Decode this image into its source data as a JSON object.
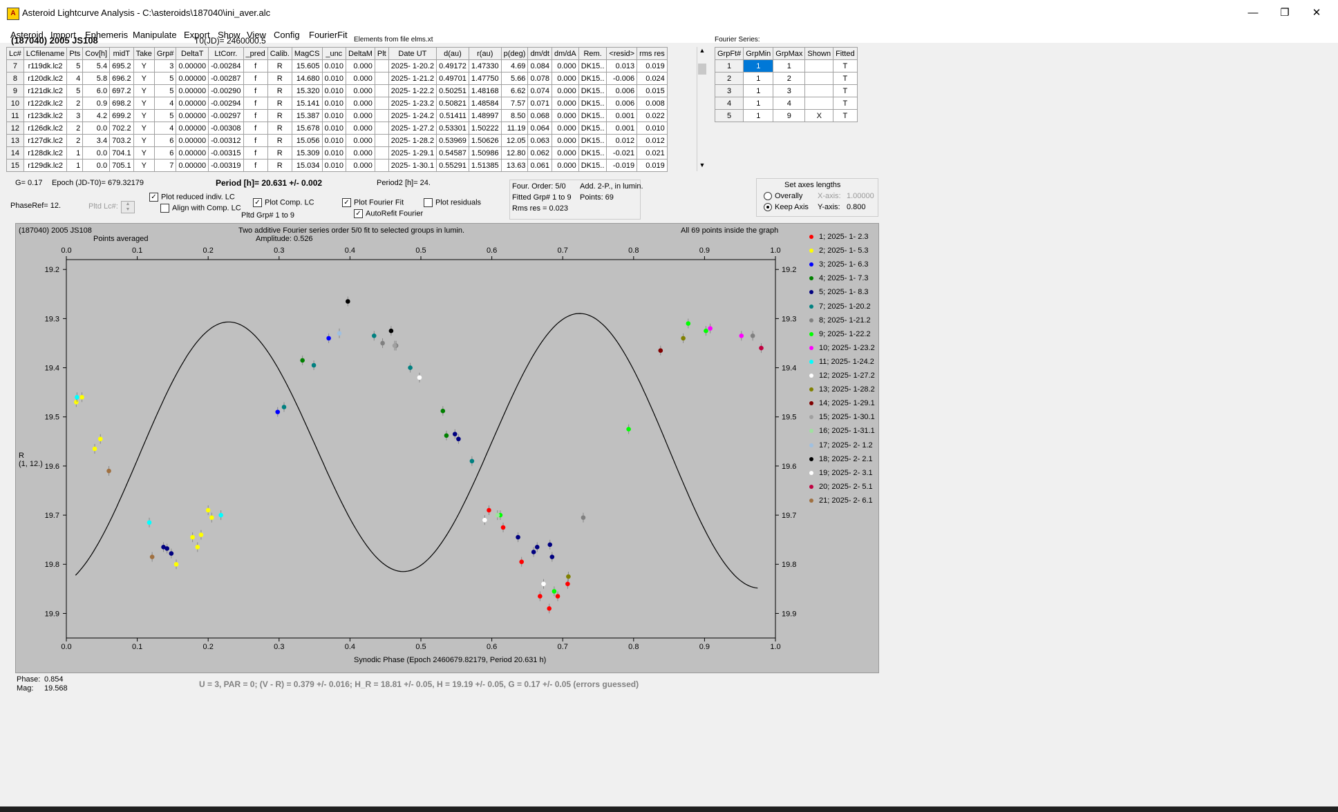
{
  "window": {
    "title": "Asteroid Lightcurve Analysis - C:\\asteroids\\187040\\ini_aver.alc",
    "minimize": "—",
    "maximize": "❐",
    "close": "✕"
  },
  "menu": [
    "Asteroid",
    "Import",
    "Ephemeris",
    "Manipulate",
    "Export",
    "Show",
    "View",
    "Config",
    "FourierFit"
  ],
  "header": {
    "object": "(187040) 2005 JS108",
    "t0": "T0(JD)= 2460000.5",
    "elements": "Elements from file elms.xt",
    "fourier_series": "Fourier Series:"
  },
  "lc_table": {
    "columns": [
      "Lc#",
      "LCfilename",
      "Pts",
      "Cov[h]",
      "midT",
      "Take",
      "Grp#",
      "DeltaT",
      "LtCorr.",
      "_pred",
      "Calib.",
      "MagCS",
      "_unc",
      "DeltaM",
      "Plt",
      "Date UT",
      "d(au)",
      "r(au)",
      "p(deg)",
      "dm/dt",
      "dm/dA",
      "Rem.",
      "<resid>",
      "rms res"
    ],
    "rows": [
      [
        "7",
        "r119dk.lc2",
        "5",
        "5.4",
        "695.2",
        "Y",
        "3",
        "0.00000",
        "-0.00284",
        "f",
        "R",
        "15.605",
        "0.010",
        "0.000",
        "",
        "2025- 1-20.2",
        "0.49172",
        "1.47330",
        "4.69",
        "0.084",
        "0.000",
        "DK15..",
        "0.013",
        "0.019"
      ],
      [
        "8",
        "r120dk.lc2",
        "4",
        "5.8",
        "696.2",
        "Y",
        "5",
        "0.00000",
        "-0.00287",
        "f",
        "R",
        "14.680",
        "0.010",
        "0.000",
        "",
        "2025- 1-21.2",
        "0.49701",
        "1.47750",
        "5.66",
        "0.078",
        "0.000",
        "DK15..",
        "-0.006",
        "0.024"
      ],
      [
        "9",
        "r121dk.lc2",
        "5",
        "6.0",
        "697.2",
        "Y",
        "5",
        "0.00000",
        "-0.00290",
        "f",
        "R",
        "15.320",
        "0.010",
        "0.000",
        "",
        "2025- 1-22.2",
        "0.50251",
        "1.48168",
        "6.62",
        "0.074",
        "0.000",
        "DK15..",
        "0.006",
        "0.015"
      ],
      [
        "10",
        "r122dk.lc2",
        "2",
        "0.9",
        "698.2",
        "Y",
        "4",
        "0.00000",
        "-0.00294",
        "f",
        "R",
        "15.141",
        "0.010",
        "0.000",
        "",
        "2025- 1-23.2",
        "0.50821",
        "1.48584",
        "7.57",
        "0.071",
        "0.000",
        "DK15..",
        "0.006",
        "0.008"
      ],
      [
        "11",
        "r123dk.lc2",
        "3",
        "4.2",
        "699.2",
        "Y",
        "5",
        "0.00000",
        "-0.00297",
        "f",
        "R",
        "15.387",
        "0.010",
        "0.000",
        "",
        "2025- 1-24.2",
        "0.51411",
        "1.48997",
        "8.50",
        "0.068",
        "0.000",
        "DK15..",
        "0.001",
        "0.022"
      ],
      [
        "12",
        "r126dk.lc2",
        "2",
        "0.0",
        "702.2",
        "Y",
        "4",
        "0.00000",
        "-0.00308",
        "f",
        "R",
        "15.678",
        "0.010",
        "0.000",
        "",
        "2025- 1-27.2",
        "0.53301",
        "1.50222",
        "11.19",
        "0.064",
        "0.000",
        "DK15..",
        "0.001",
        "0.010"
      ],
      [
        "13",
        "r127dk.lc2",
        "2",
        "3.4",
        "703.2",
        "Y",
        "6",
        "0.00000",
        "-0.00312",
        "f",
        "R",
        "15.056",
        "0.010",
        "0.000",
        "",
        "2025- 1-28.2",
        "0.53969",
        "1.50626",
        "12.05",
        "0.063",
        "0.000",
        "DK15..",
        "0.012",
        "0.012"
      ],
      [
        "14",
        "r128dk.lc2",
        "1",
        "0.0",
        "704.1",
        "Y",
        "6",
        "0.00000",
        "-0.00315",
        "f",
        "R",
        "15.309",
        "0.010",
        "0.000",
        "",
        "2025- 1-29.1",
        "0.54587",
        "1.50986",
        "12.80",
        "0.062",
        "0.000",
        "DK15..",
        "-0.021",
        "0.021"
      ],
      [
        "15",
        "r129dk.lc2",
        "1",
        "0.0",
        "705.1",
        "Y",
        "7",
        "0.00000",
        "-0.00319",
        "f",
        "R",
        "15.034",
        "0.010",
        "0.000",
        "",
        "2025- 1-30.1",
        "0.55291",
        "1.51385",
        "13.63",
        "0.061",
        "0.000",
        "DK15..",
        "-0.019",
        "0.019"
      ]
    ]
  },
  "fourier_table": {
    "columns": [
      "GrpFt#",
      "GrpMin",
      "GrpMax",
      "Shown",
      "Fitted"
    ],
    "rows": [
      [
        "1",
        "1",
        "1",
        "",
        "T"
      ],
      [
        "2",
        "1",
        "2",
        "",
        "T"
      ],
      [
        "3",
        "1",
        "3",
        "",
        "T"
      ],
      [
        "4",
        "1",
        "4",
        "",
        "T"
      ],
      [
        "5",
        "1",
        "9",
        "X",
        "T"
      ]
    ]
  },
  "info": {
    "g": "G= 0.17",
    "epoch": "Epoch (JD-T0)= 679.32179",
    "period": "Period [h]= 20.631 +/- 0.002",
    "period2": "Period2 [h]= 24.",
    "phaseref": "PhaseRef= 12.",
    "pltd_lc": "Pltd Lc#:",
    "plot_reduced": "Plot reduced indiv. LC",
    "align": "Align with Comp. LC",
    "plot_comp": "Plot Comp. LC",
    "pltd_grp": "Pltd Grp#  1   to   9",
    "plot_fourier": "Plot Fourier Fit",
    "autorefit": "AutoRefit Fourier",
    "plot_residuals": "Plot residuals",
    "four_order": "Four. Order:  5/0",
    "add": "Add. 2-P., in lumin.",
    "fitted_grp": "Fitted Grp# 1 to 9",
    "points": "Points: 69",
    "rms": "Rms res     = 0.023",
    "set_axes": "Set axes lengths",
    "overally": "Overally",
    "keep_axis": "Keep Axis",
    "xaxis_label": "X-axis:",
    "xaxis_val": "1.00000",
    "yaxis_label": "Y-axis:",
    "yaxis_val": "0.800"
  },
  "plot": {
    "object": "(187040) 2005 JS108",
    "subtitle": "Points averaged",
    "title": "Two additive Fourier series order 5/0 fit to selected groups in lumin.",
    "amplitude": "Amplitude: 0.526",
    "inside": "All 69 points inside the graph",
    "ylabel1": "R",
    "ylabel2": "(1, 12.)",
    "xlabel": "Synodic Phase (Epoch 2460679.82179, Period 20.631 h)"
  },
  "chart_data": {
    "type": "scatter",
    "xlim": [
      0,
      1
    ],
    "ylim": [
      19.95,
      19.18
    ],
    "x_ticks": [
      "0.0",
      "0.1",
      "0.2",
      "0.3",
      "0.4",
      "0.5",
      "0.6",
      "0.7",
      "0.8",
      "0.9",
      "1.0"
    ],
    "y_ticks": [
      "19.2",
      "19.3",
      "19.4",
      "19.5",
      "19.6",
      "19.7",
      "19.8",
      "19.9"
    ],
    "fourier_curve": {
      "mean": 19.565,
      "a1": 0.018,
      "b1": 0.006,
      "a2": 0.255,
      "b2": -0.078
    },
    "series": [
      {
        "name": "1; 2025- 1- 2.3",
        "color": "#ff0000",
        "x": [
          0.596,
          0.616,
          0.642,
          0.668,
          0.681,
          0.693,
          0.707
        ],
        "y": [
          19.69,
          19.725,
          19.795,
          19.865,
          19.89,
          19.865,
          19.84
        ]
      },
      {
        "name": "2; 2025- 1- 5.3",
        "color": "#ffff00",
        "x": [
          0.014,
          0.022,
          0.04,
          0.048,
          0.155,
          0.178,
          0.185,
          0.19,
          0.2,
          0.205
        ],
        "y": [
          19.47,
          19.46,
          19.565,
          19.545,
          19.8,
          19.745,
          19.765,
          19.74,
          19.69,
          19.705
        ]
      },
      {
        "name": "3; 2025- 1- 6.3",
        "color": "#0000ff",
        "x": [
          0.298,
          0.37
        ],
        "y": [
          19.49,
          19.34
        ]
      },
      {
        "name": "4; 2025- 1- 7.3",
        "color": "#008000",
        "x": [
          0.333,
          0.531,
          0.536
        ],
        "y": [
          19.385,
          19.488,
          19.538
        ]
      },
      {
        "name": "5; 2025- 1- 8.3",
        "color": "#000080",
        "x": [
          0.137,
          0.142,
          0.148,
          0.548,
          0.553,
          0.637,
          0.659,
          0.664,
          0.682,
          0.685
        ],
        "y": [
          19.765,
          19.768,
          19.778,
          19.535,
          19.545,
          19.745,
          19.775,
          19.765,
          19.76,
          19.785
        ]
      },
      {
        "name": "7; 2025- 1-20.2",
        "color": "#008080",
        "x": [
          0.307,
          0.349,
          0.434,
          0.485,
          0.572
        ],
        "y": [
          19.48,
          19.395,
          19.335,
          19.4,
          19.59
        ]
      },
      {
        "name": "8; 2025- 1-21.2",
        "color": "#808080",
        "x": [
          0.446,
          0.465,
          0.729,
          0.968
        ],
        "y": [
          19.35,
          19.355,
          19.705,
          19.335
        ]
      },
      {
        "name": "9; 2025- 1-22.2",
        "color": "#00ff00",
        "x": [
          0.612,
          0.688,
          0.793,
          0.877,
          0.902
        ],
        "y": [
          19.7,
          19.855,
          19.525,
          19.31,
          19.325
        ]
      },
      {
        "name": "10; 2025- 1-23.2",
        "color": "#ff00ff",
        "x": [
          0.908,
          0.952
        ],
        "y": [
          19.32,
          19.335
        ]
      },
      {
        "name": "11; 2025- 1-24.2",
        "color": "#00ffff",
        "x": [
          0.015,
          0.117,
          0.218
        ],
        "y": [
          19.46,
          19.715,
          19.7
        ]
      },
      {
        "name": "12; 2025- 1-27.2",
        "color": "#ffffff",
        "x": [
          0.59,
          0.673
        ],
        "y": [
          19.71,
          19.84
        ]
      },
      {
        "name": "13; 2025- 1-28.2",
        "color": "#808000",
        "x": [
          0.708,
          0.87
        ],
        "y": [
          19.825,
          19.34
        ]
      },
      {
        "name": "14; 2025- 1-29.1",
        "color": "#800000",
        "x": [
          0.838
        ],
        "y": [
          19.365
        ]
      },
      {
        "name": "15; 2025- 1-30.1",
        "color": "#a0a0a0",
        "x": [
          0.463
        ],
        "y": [
          19.355
        ]
      },
      {
        "name": "16; 2025- 1-31.1",
        "color": "#a0e0a0",
        "x": [
          0.608
        ],
        "y": [
          19.7
        ]
      },
      {
        "name": "17; 2025- 2- 1.2",
        "color": "#a0c0e0",
        "x": [
          0.385
        ],
        "y": [
          19.33
        ]
      },
      {
        "name": "18; 2025- 2- 2.1",
        "color": "#000000",
        "x": [
          0.397,
          0.458
        ],
        "y": [
          19.265,
          19.325
        ]
      },
      {
        "name": "19; 2025- 2- 3.1",
        "color": "#ffffff",
        "x": [
          0.498
        ],
        "y": [
          19.42
        ]
      },
      {
        "name": "20; 2025- 2- 5.1",
        "color": "#c00040",
        "x": [
          0.98
        ],
        "y": [
          19.36
        ]
      },
      {
        "name": "21; 2025- 2- 6.1",
        "color": "#a07040",
        "x": [
          0.06,
          0.121
        ],
        "y": [
          19.61,
          19.785
        ]
      }
    ]
  },
  "status": {
    "phase_label": "Phase:",
    "phase_val": "0.854",
    "mag_label": "Mag:",
    "mag_val": "19.568",
    "result": "U = 3, PAR = 0; (V - R) = 0.379 +/- 0.016; H_R = 18.81 +/- 0.05, H = 19.19 +/- 0.05, G = 0.17 +/- 0.05 (errors guessed)"
  }
}
